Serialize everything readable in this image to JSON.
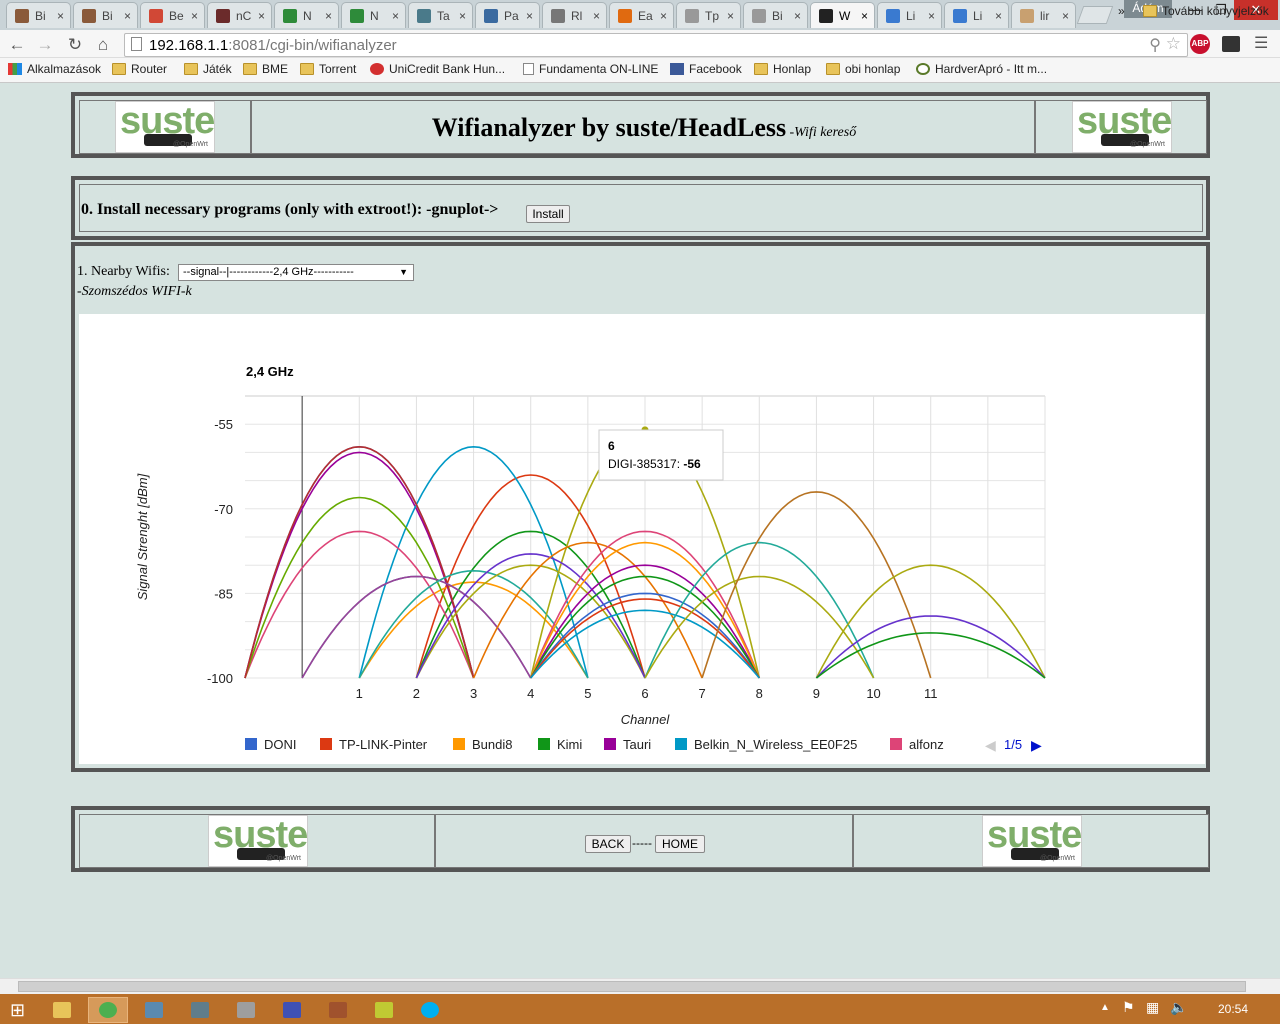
{
  "browser": {
    "tabs": [
      {
        "label": "Bi",
        "color": "#8a5a3a"
      },
      {
        "label": "Bi",
        "color": "#8a5a3a"
      },
      {
        "label": "Be",
        "color": "#d14836"
      },
      {
        "label": "nC",
        "color": "#6b2b2b"
      },
      {
        "label": "N",
        "color": "#2e8b3a"
      },
      {
        "label": "N",
        "color": "#2e8b3a"
      },
      {
        "label": "Ta",
        "color": "#4a7a8a"
      },
      {
        "label": "Pa",
        "color": "#3a6aa0"
      },
      {
        "label": "Rl",
        "color": "#777777"
      },
      {
        "label": "Ea",
        "color": "#e06a10"
      },
      {
        "label": "Tp",
        "color": "#999999"
      },
      {
        "label": "Bi",
        "color": "#999999"
      },
      {
        "label": "W",
        "color": "#222222"
      },
      {
        "label": "Li",
        "color": "#3a7ad0"
      },
      {
        "label": "Li",
        "color": "#3a7ad0"
      },
      {
        "label": "lir",
        "color": "#c8a070"
      }
    ],
    "active_tab_index": 12,
    "user_name": "Ádám",
    "url_host": "192.168.1.1",
    "url_rest": ":8081/cgi-bin/wifianalyzer",
    "bookmarks": [
      {
        "label": "Alkalmazások",
        "icon": "apps-icon"
      },
      {
        "label": "Router",
        "icon": "folder-icon"
      },
      {
        "label": "Játék",
        "icon": "folder-icon"
      },
      {
        "label": "BME",
        "icon": "folder-icon"
      },
      {
        "label": "Torrent",
        "icon": "folder-icon"
      },
      {
        "label": "UniCredit Bank Hun...",
        "icon": "unicredit-icon"
      },
      {
        "label": "Fundamenta ON-LINE",
        "icon": "page-icon"
      },
      {
        "label": "Facebook",
        "icon": "facebook-icon"
      },
      {
        "label": "Honlap",
        "icon": "folder-icon"
      },
      {
        "label": "obi honlap",
        "icon": "folder-icon"
      },
      {
        "label": "HardverApró - Itt m...",
        "icon": "hardverapro-icon"
      }
    ],
    "more_bookmarks": "»",
    "other_bookmarks": "További könyvjelzők",
    "abp_label": "ABP"
  },
  "header": {
    "title": "Wifianalyzer by suste/HeadLess",
    "subtitle": "-Wifi kereső",
    "logo_text": "suste",
    "logo_sub": "@OpenWrt"
  },
  "install": {
    "text": "0. Install necessary programs (only with extroot!): -gnuplot->",
    "button": "Install"
  },
  "nearby": {
    "label": "1. Nearby Wifis:",
    "select_value": "--signal--|------------2,4 GHz-----------",
    "subtitle": "-Szomszédos WIFI-k"
  },
  "chart_data": {
    "type": "line",
    "title": "2,4 GHz",
    "xlabel": "Channel",
    "ylabel": "Signal Strenght [dBm]",
    "ylim": [
      -100,
      -50
    ],
    "yticks": [
      -55,
      -70,
      -85,
      -100
    ],
    "xticks": [
      "1",
      "2",
      "3",
      "4",
      "5",
      "6",
      "7",
      "8",
      "9",
      "10",
      "11"
    ],
    "x_range": [
      -1,
      13
    ],
    "grid": true,
    "legend_position": "bottom",
    "legend_page": "1/5",
    "tooltip": {
      "x": "6",
      "series": "DIGI-385317",
      "value": "-56"
    },
    "series": [
      {
        "name": "DONI",
        "color": "#3366cc",
        "center": 1,
        "peak": -59
      },
      {
        "name": "TP-LINK-Pinter",
        "color": "#dc3912",
        "center": 4,
        "peak": -64
      },
      {
        "name": "Bundi8",
        "color": "#ff9900",
        "center": 3,
        "peak": -83
      },
      {
        "name": "Kimi",
        "color": "#109618",
        "center": 4,
        "peak": -74
      },
      {
        "name": "Tauri",
        "color": "#990099",
        "center": 1,
        "peak": -60
      },
      {
        "name": "Belkin_N_Wireless_EE0F25",
        "color": "#0099c6",
        "center": 3,
        "peak": -59
      },
      {
        "name": "alfonz",
        "color": "#dd4477",
        "center": 1,
        "peak": -74
      },
      {
        "center": 1,
        "peak": -68,
        "color": "#66aa00"
      },
      {
        "center": 1,
        "peak": -59,
        "color": "#b82e2e"
      },
      {
        "center": 2,
        "peak": -82,
        "color": "#316395"
      },
      {
        "center": 2,
        "peak": -82,
        "color": "#994499"
      },
      {
        "center": 3,
        "peak": -81,
        "color": "#22aa99"
      },
      {
        "center": 4,
        "peak": -80,
        "color": "#aaaa11"
      },
      {
        "center": 6,
        "peak": -56,
        "color": "#aaaa11"
      },
      {
        "center": 4,
        "peak": -78,
        "color": "#6633cc"
      },
      {
        "center": 5,
        "peak": -76,
        "color": "#e67300"
      },
      {
        "center": 6,
        "peak": -74,
        "color": "#dd4477"
      },
      {
        "center": 6,
        "peak": -80,
        "color": "#990099"
      },
      {
        "center": 6,
        "peak": -76,
        "color": "#ff9900"
      },
      {
        "center": 6,
        "peak": -82,
        "color": "#109618"
      },
      {
        "center": 6,
        "peak": -85,
        "color": "#3366cc"
      },
      {
        "center": 6,
        "peak": -86,
        "color": "#dc3912"
      },
      {
        "center": 6,
        "peak": -88,
        "color": "#0099c6"
      },
      {
        "center": 8,
        "peak": -76,
        "color": "#22aa99"
      },
      {
        "center": 8,
        "peak": -82,
        "color": "#aaaa11"
      },
      {
        "center": 9,
        "peak": -67,
        "color": "#b77322"
      },
      {
        "center": 11,
        "peak": -80,
        "color": "#aaaa11"
      },
      {
        "center": 11,
        "peak": -89,
        "color": "#6633cc"
      },
      {
        "center": 11,
        "peak": -92,
        "color": "#109618"
      }
    ]
  },
  "footer": {
    "back": "BACK",
    "separator": "-----",
    "home": "HOME"
  },
  "taskbar": {
    "clock": "20:54",
    "apps": [
      {
        "name": "explorer-icon",
        "color": "#e8c45a"
      },
      {
        "name": "chrome-icon",
        "color": "#4caf50"
      },
      {
        "name": "network-icon",
        "color": "#5a8ab0"
      },
      {
        "name": "remote-icon",
        "color": "#607d8b"
      },
      {
        "name": "image-viewer-icon",
        "color": "#9e9e9e"
      },
      {
        "name": "save-icon",
        "color": "#3f51b5"
      },
      {
        "name": "archive-icon",
        "color": "#a0522d"
      },
      {
        "name": "notepad-icon",
        "color": "#c0ca33"
      },
      {
        "name": "skype-icon",
        "color": "#00aff0"
      }
    ]
  }
}
